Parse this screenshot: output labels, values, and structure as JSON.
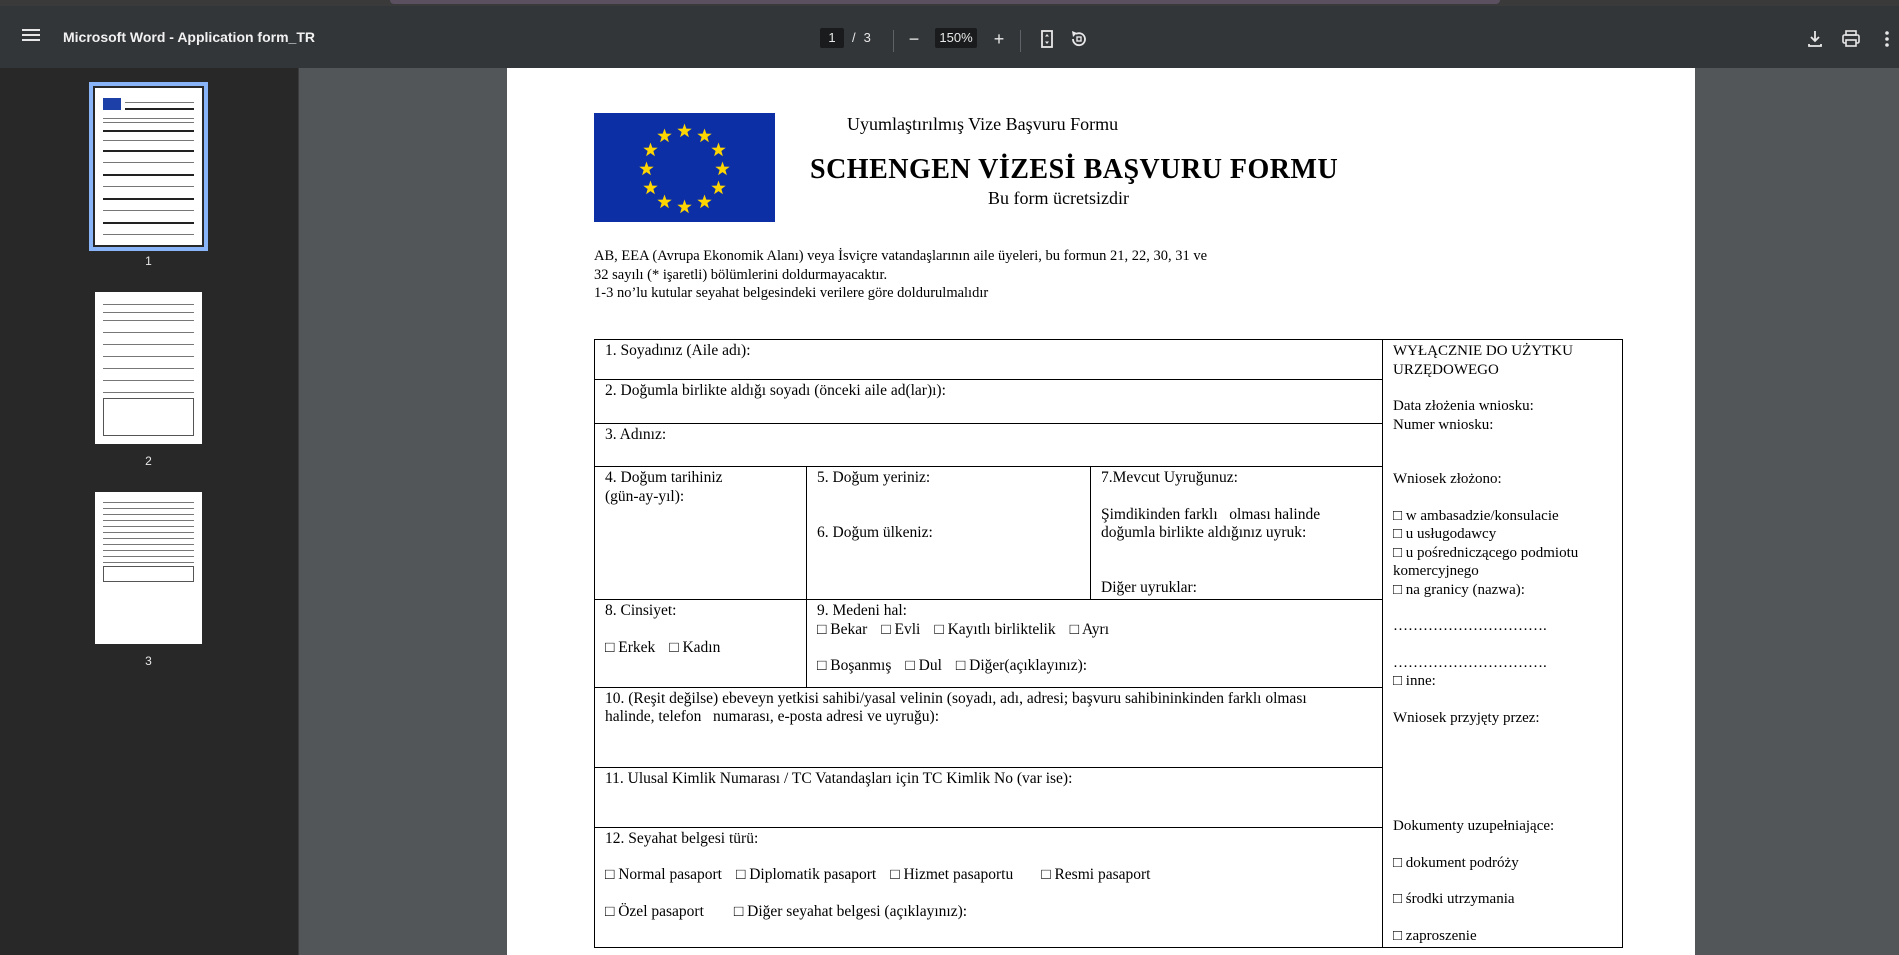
{
  "app": {
    "document_title": "Microsoft Word - Application form_TR",
    "current_page": "1",
    "page_separator": "/",
    "total_pages": "3",
    "zoom": "150%",
    "zoom_out_symbol": "−",
    "zoom_in_symbol": "+",
    "icons": [
      "menu-icon",
      "zoom-out-icon",
      "zoom-in-icon",
      "fit-page-icon",
      "rotate-icon",
      "download-icon",
      "print-icon",
      "more-icon"
    ]
  },
  "thumbnails": [
    {
      "label": "1",
      "selected": true
    },
    {
      "label": "2",
      "selected": false
    },
    {
      "label": "3",
      "selected": false
    }
  ],
  "document": {
    "header_sub": "Uyumlaştırılmış Vize Başvuru Formu",
    "header_main": "SCHENGEN VİZESİ BAŞVURU FORMU",
    "header_free": "Bu form ücretsizdir",
    "intro": [
      "AB, EEA (Avrupa Ekonomik Alanı) veya İsviçre vatandaşlarının aile üyeleri, bu formun 21, 22, 30, 31 ve",
      "32 sayılı (* işaretli) bölümlerini doldurmayacaktır.",
      "1-3 no’lu kutular seyahat belgesindeki verilere göre doldurulmalıdır"
    ],
    "fields": {
      "f1": "1. Soyadınız (Aile adı):",
      "f2": "2. Doğumla birlikte aldığı soyadı (önceki aile ad(lar)ı):",
      "f3": "3. Adınız:",
      "f4a": "4. Doğum tarihiniz",
      "f4b": "(gün-ay-yıl):",
      "f5": "5. Doğum yeriniz:",
      "f6": "6. Doğum ülkeniz:",
      "f7": "7.Mevcut Uyruğunuz:",
      "f7b1": "Şimdikinden farklı   olması halinde",
      "f7b2": "doğumla birlikte aldığınız uyruk:",
      "f7c": "Diğer uyruklar:",
      "f8": "8. Cinsiyet:",
      "f8_male": "□ Erkek",
      "f8_female": "□ Kadın",
      "f9": "9. Medeni hal:",
      "f9_single": "□ Bekar",
      "f9_married": "□ Evli",
      "f9_partner": "□ Kayıtlı birliktelik",
      "f9_separated": "□ Ayrı",
      "f9_divorced": "□ Boşanmış",
      "f9_widow": "□ Dul",
      "f9_other": "□ Diğer(açıklayınız):",
      "f10a": "10. (Reşit değilse) ebeveyn yetkisi sahibi/yasal velinin (soyadı, adı, adresi; başvuru sahibininkinden farklı olması",
      "f10b": "halinde, telefon   numarası, e-posta adresi ve uyruğu):",
      "f11": "11. Ulusal Kimlik Numarası / TC Vatandaşları için TC Kimlik No (var ise):",
      "f12": "12. Seyahat belgesi türü:",
      "f12_normal": "□ Normal pasaport",
      "f12_diplomatic": "□ Diplomatik pasaport",
      "f12_service": "□ Hizmet pasaportu",
      "f12_official": "□ Resmi pasaport",
      "f12_special": "□ Özel pasaport",
      "f12_other": "□ Diğer seyahat belgesi (açıklayınız):"
    },
    "official_use": {
      "title1": "WYŁĄCZNIE DO UŻYTKU",
      "title2": "URZĘDOWEGO",
      "date": "Data złożenia wniosku:",
      "number": "Numer wniosku:",
      "lodged": "Wniosek złożono:",
      "opt1": "□ w ambasadzie/konsulacie",
      "opt2": "□ u usługodawcy",
      "opt3a": "□ u pośredniczącego podmiotu",
      "opt3b": "komercyjnego",
      "opt4": "□ na granicy (nazwa):",
      "dots1": "………………………….",
      "dots2": "………………………….",
      "opt5": "□ inne:",
      "accepted": "Wniosek przyjęty przez:",
      "supporting": "Dokumenty uzupełniające:",
      "doc1": "□ dokument podróży",
      "doc2": "□ środki utrzymania",
      "doc3": "□ zaproszenie"
    }
  }
}
